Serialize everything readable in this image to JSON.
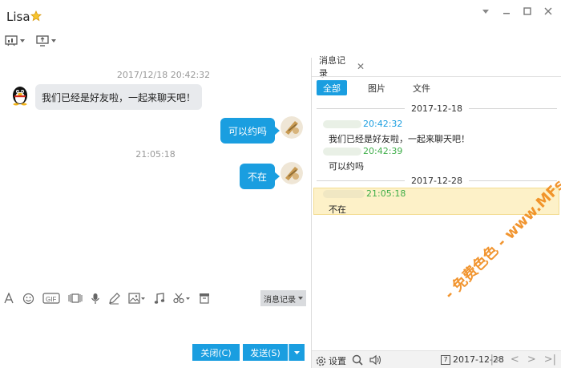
{
  "window": {
    "contact_name": "Lisa",
    "controls": [
      "chevron-down-icon",
      "minimize-icon",
      "maximize-icon",
      "close-icon"
    ]
  },
  "top_toolbar": {
    "items": [
      {
        "icon": "chart-board-icon",
        "has_dropdown": true
      },
      {
        "icon": "screen-share-icon",
        "has_dropdown": true
      }
    ]
  },
  "chat": {
    "messages": [
      {
        "type": "timestamp",
        "text": "2017/12/18 20:42:32"
      },
      {
        "type": "incoming",
        "text": "我们已经是好友啦，一起来聊天吧！"
      },
      {
        "type": "outgoing",
        "text": "可以约吗"
      },
      {
        "type": "timestamp",
        "text": "21:05:18"
      },
      {
        "type": "outgoing",
        "text": "不在"
      }
    ]
  },
  "input_toolbar": {
    "icons": [
      "font-icon",
      "emoji-icon",
      "gif-icon",
      "video-icon",
      "mic-icon",
      "pen-icon",
      "image-icon",
      "music-icon",
      "scissors-icon",
      "archive-icon"
    ],
    "history_button_label": "消息记录"
  },
  "actions": {
    "close_label": "关闭(C)",
    "send_label": "发送(S)"
  },
  "history": {
    "tab_label": "消息记录",
    "filters": [
      "全部",
      "图片",
      "文件"
    ],
    "active_filter": "全部",
    "groups": [
      {
        "date": "2017-12-18",
        "entries": [
          {
            "time": "20:42:32",
            "text": "我们已经是好友啦，一起来聊天吧！",
            "time_color": "#1a9ee0"
          },
          {
            "time": "20:42:39",
            "text": "可以约吗",
            "time_color": "#3fae49"
          }
        ]
      },
      {
        "date": "2017-12-28",
        "entries": [
          {
            "time": "21:05:18",
            "text": "不在",
            "time_color": "#3fae49",
            "highlighted": true
          }
        ]
      }
    ],
    "bottom": {
      "settings_label": "设置",
      "calendar_day": "7",
      "date_label": "2017-12-28"
    }
  },
  "watermark": {
    "text": "- 免费色色 - www.MFsese.com",
    "color": "#f08a1a"
  },
  "colors": {
    "accent": "#1a9ee0",
    "incoming_bubble": "#e8eaed",
    "highlight_row": "#fdf1c8"
  }
}
